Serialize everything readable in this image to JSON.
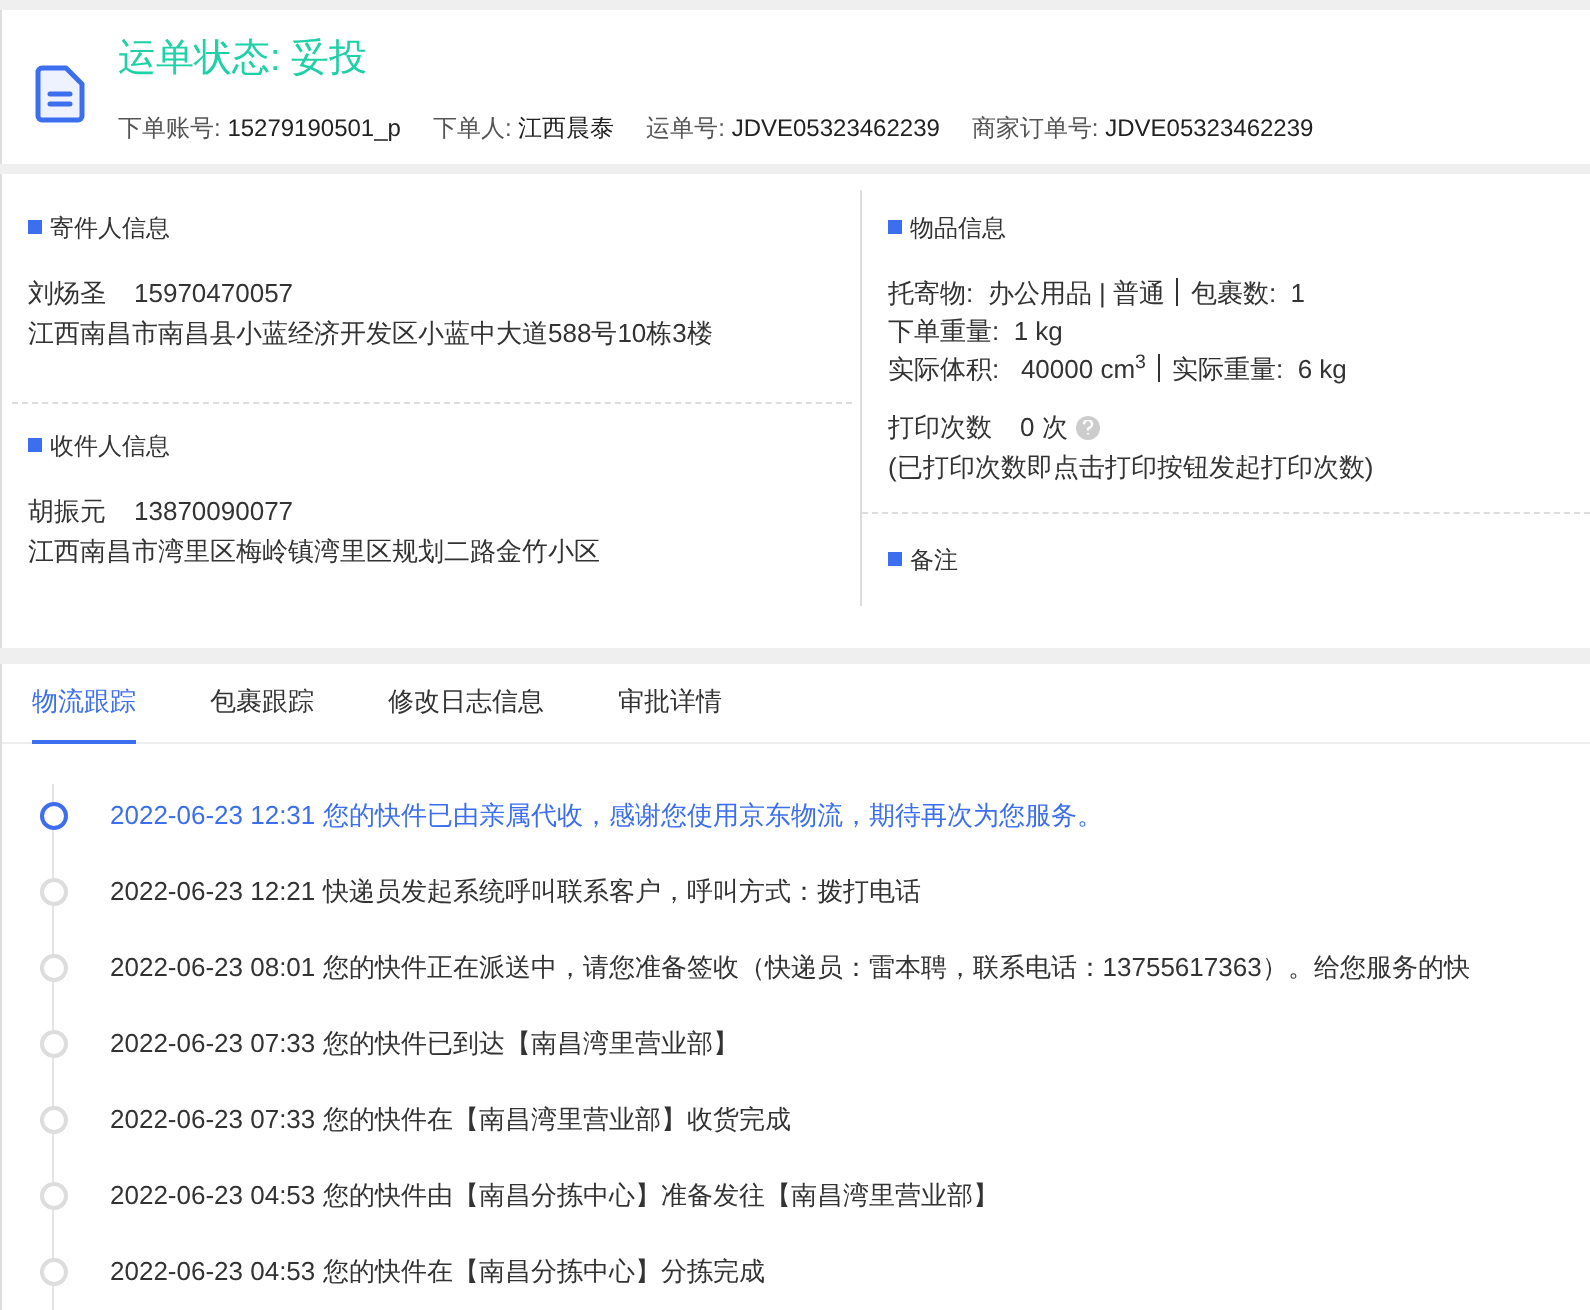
{
  "header": {
    "status": "运单状态: 妥投",
    "meta": [
      {
        "label": "下单账号:",
        "value": "15279190501_p"
      },
      {
        "label": "下单人:",
        "value": "江西晨泰"
      },
      {
        "label": "运单号:",
        "value": "JDVE05323462239"
      },
      {
        "label": "商家订单号:",
        "value": "JDVE05323462239"
      }
    ]
  },
  "sender": {
    "title": "寄件人信息",
    "name": "刘炀圣",
    "phone": "15970470057",
    "address": "江西南昌市南昌县小蓝经济开发区小蓝中大道588号10栋3楼"
  },
  "receiver": {
    "title": "收件人信息",
    "name": "胡振元",
    "phone": "13870090077",
    "address": "江西南昌市湾里区梅岭镇湾里区规划二路金竹小区"
  },
  "goods": {
    "title": "物品信息",
    "lines": [
      [
        "托寄物:  办公用品 | 普通",
        "包裹数:  1"
      ],
      [
        "下单重量:  1 kg"
      ],
      [
        "实际体积:   40000 cm$^{3}$",
        "实际重量:  6 kg"
      ]
    ],
    "print_label": "打印次数",
    "print_count": "0 次",
    "print_note": "(已打印次数即点击打印按钮发起打印次数)"
  },
  "remark": {
    "title": "备注"
  },
  "tabs": [
    {
      "label": "物流跟踪",
      "selected": true
    },
    {
      "label": "包裹跟踪",
      "selected": false
    },
    {
      "label": "修改日志信息",
      "selected": false
    },
    {
      "label": "审批详情",
      "selected": false
    }
  ],
  "timeline": [
    {
      "time": "2022-06-23 12:31",
      "text": "您的快件已由亲属代收，感谢您使用京东物流，期待再次为您服务。",
      "active": true
    },
    {
      "time": "2022-06-23 12:21",
      "text": "快递员发起系统呼叫联系客户，呼叫方式：拨打电话",
      "active": false
    },
    {
      "time": "2022-06-23 08:01",
      "text": "您的快件正在派送中，请您准备签收（快递员：雷本聘，联系电话：13755617363）。给您服务的快",
      "active": false
    },
    {
      "time": "2022-06-23 07:33",
      "text": "您的快件已到达【南昌湾里营业部】",
      "active": false
    },
    {
      "time": "2022-06-23 07:33",
      "text": "您的快件在【南昌湾里营业部】收货完成",
      "active": false
    },
    {
      "time": "2022-06-23 04:53",
      "text": "您的快件由【南昌分拣中心】准备发往【南昌湾里营业部】",
      "active": false
    },
    {
      "time": "2022-06-23 04:53",
      "text": "您的快件在【南昌分拣中心】分拣完成",
      "active": false
    }
  ]
}
